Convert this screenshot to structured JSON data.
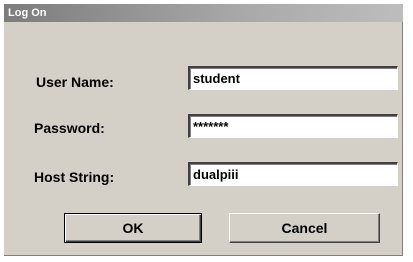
{
  "window": {
    "title": "Log On"
  },
  "form": {
    "username": {
      "label": "User Name:",
      "value": "student"
    },
    "password": {
      "label": "Password:",
      "value": "*******"
    },
    "host": {
      "label": "Host String:",
      "value": "dualpiii"
    }
  },
  "buttons": {
    "ok_label": "OK",
    "cancel_label": "Cancel"
  }
}
